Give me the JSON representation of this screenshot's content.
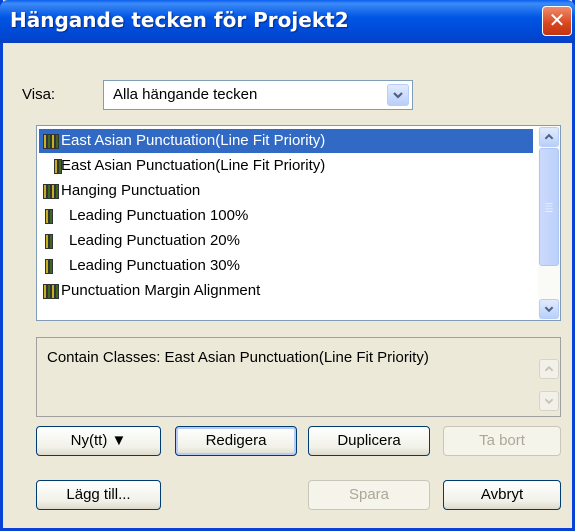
{
  "window": {
    "title": "Hängande tecken för Projekt2",
    "close_glyph": "✕"
  },
  "filter": {
    "label": "Visa:",
    "selected": "Alla hängande tecken"
  },
  "list": {
    "items": [
      {
        "label": "East Asian Punctuation(Line Fit Priority)",
        "icon": "punctuation-set-icon",
        "selected": true
      },
      {
        "label": "East Asian Punctuation(Line Fit Priority)",
        "icon": "punctuation-set-icon",
        "selected": false
      },
      {
        "label": "Hanging Punctuation",
        "icon": "punctuation-set-icon",
        "selected": false
      },
      {
        "label": "Leading Punctuation 100%",
        "icon": "punctuation-class-icon",
        "selected": false
      },
      {
        "label": "Leading Punctuation 20%",
        "icon": "punctuation-class-icon",
        "selected": false
      },
      {
        "label": "Leading Punctuation 30%",
        "icon": "punctuation-class-icon",
        "selected": false
      },
      {
        "label": "Punctuation Margin Alignment",
        "icon": "punctuation-set-icon",
        "selected": false
      }
    ]
  },
  "description": {
    "text": "Contain Classes: East Asian Punctuation(Line Fit Priority)"
  },
  "buttons": {
    "new": "Ny(tt) ▼",
    "edit": "Redigera",
    "duplicate": "Duplicera",
    "delete": "Ta bort",
    "append": "Lägg till...",
    "save": "Spara",
    "cancel": "Avbryt"
  },
  "colors": {
    "titlebar": "#0055e5",
    "selection": "#316ac5",
    "dialog_bg": "#ece9d8"
  }
}
